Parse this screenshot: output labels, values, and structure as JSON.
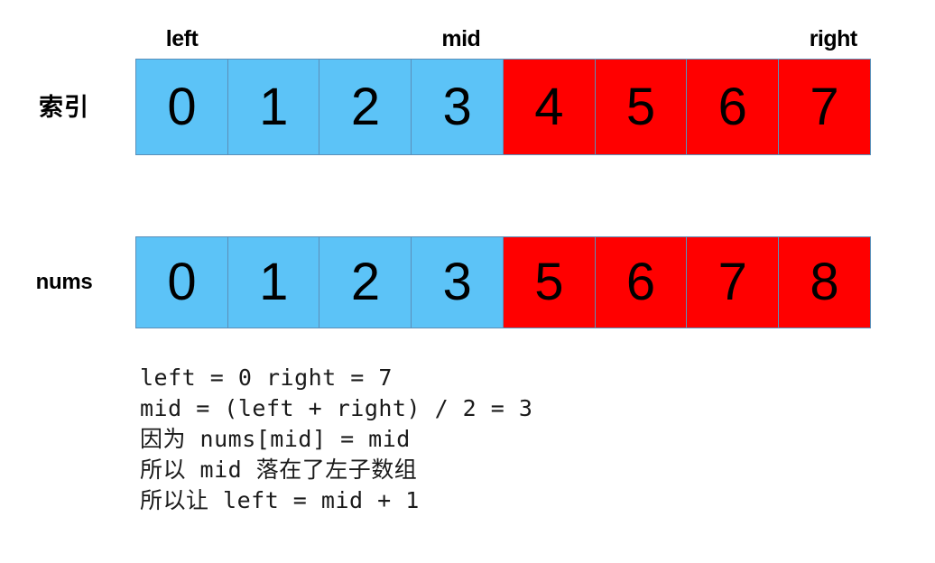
{
  "diagram": {
    "title": "binary-search-missing-number-step",
    "pointer_labels": [
      {
        "name": "left",
        "text": "left",
        "index": 0
      },
      {
        "name": "mid",
        "text": "mid",
        "index": 3
      },
      {
        "name": "right",
        "text": "right",
        "index": 7
      }
    ],
    "colors": {
      "blue": "#5CC3F7",
      "red": "#FF0000",
      "border": "#5B8FB9",
      "text": "#000000",
      "background": "#FFFFFF"
    },
    "rows": [
      {
        "name": "index-row",
        "label": "索引",
        "label_script": "cjk",
        "cells": [
          {
            "value": "0",
            "color": "blue"
          },
          {
            "value": "1",
            "color": "blue"
          },
          {
            "value": "2",
            "color": "blue"
          },
          {
            "value": "3",
            "color": "blue"
          },
          {
            "value": "4",
            "color": "red"
          },
          {
            "value": "5",
            "color": "red"
          },
          {
            "value": "6",
            "color": "red"
          },
          {
            "value": "7",
            "color": "red"
          }
        ]
      },
      {
        "name": "nums-row",
        "label": "nums",
        "label_script": "lat",
        "cells": [
          {
            "value": "0",
            "color": "blue"
          },
          {
            "value": "1",
            "color": "blue"
          },
          {
            "value": "2",
            "color": "blue"
          },
          {
            "value": "3",
            "color": "blue"
          },
          {
            "value": "5",
            "color": "red"
          },
          {
            "value": "6",
            "color": "red"
          },
          {
            "value": "7",
            "color": "red"
          },
          {
            "value": "8",
            "color": "red"
          }
        ]
      }
    ],
    "explanation_lines": [
      "left = 0 right = 7",
      "mid = (left + right) / 2 = 3",
      "因为 nums[mid] = mid",
      "所以 mid 落在了左子数组",
      "所以让 left = mid + 1"
    ]
  }
}
